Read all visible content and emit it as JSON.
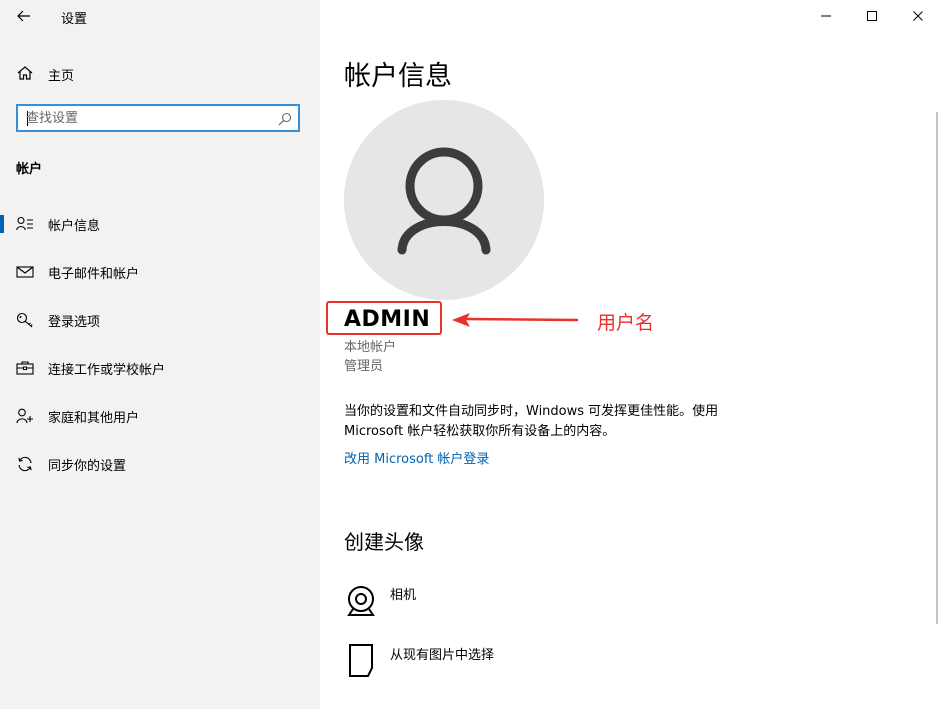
{
  "window": {
    "title": "设置",
    "controls": [
      "minimize",
      "maximize",
      "close"
    ]
  },
  "sidebar": {
    "home_label": "主页",
    "search_placeholder": "查找设置",
    "section_title": "帐户",
    "items": [
      {
        "label": "帐户信息",
        "icon": "account-info-icon",
        "active": true
      },
      {
        "label": "电子邮件和帐户",
        "icon": "email-icon",
        "active": false
      },
      {
        "label": "登录选项",
        "icon": "key-icon",
        "active": false
      },
      {
        "label": "连接工作或学校帐户",
        "icon": "briefcase-icon",
        "active": false
      },
      {
        "label": "家庭和其他用户",
        "icon": "person-add-icon",
        "active": false
      },
      {
        "label": "同步你的设置",
        "icon": "sync-icon",
        "active": false
      }
    ]
  },
  "main": {
    "title": "帐户信息",
    "username": "ADMIN",
    "account_type": "本地帐户",
    "account_role": "管理员",
    "description": "当你的设置和文件自动同步时，Windows 可发挥更佳性能。使用 Microsoft 帐户轻松获取你所有设备上的内容。",
    "ms_link": "改用 Microsoft 帐户登录",
    "create_avatar_title": "创建头像",
    "options": [
      {
        "label": "相机",
        "icon": "camera-icon"
      },
      {
        "label": "从现有图片中选择",
        "icon": "picture-icon"
      }
    ]
  },
  "annotation": {
    "label": "用户名",
    "color": "#e8322b"
  },
  "colors": {
    "sidebar_bg": "#f2f2f2",
    "accent": "#0063b1",
    "search_border": "#3a8ed8",
    "avatar_bg": "#e6e6e6"
  }
}
